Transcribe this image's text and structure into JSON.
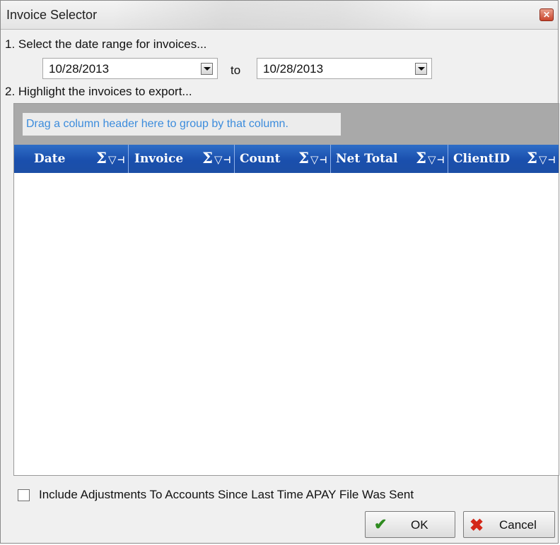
{
  "window": {
    "title": "Invoice Selector"
  },
  "steps": {
    "step1": "1.  Select the date range for invoices...",
    "step2": "2.  Highlight the invoices to export..."
  },
  "date_range": {
    "from": "10/28/2013",
    "to_label": "to",
    "to": "10/28/2013"
  },
  "grid": {
    "group_hint": "Drag a column header here to group by that column.",
    "columns": [
      {
        "label": "Date"
      },
      {
        "label": "Invoice"
      },
      {
        "label": "Count"
      },
      {
        "label": "Net Total"
      },
      {
        "label": "ClientID"
      }
    ],
    "column_icons": {
      "sum": "Σ",
      "filter": "▽",
      "pin": "⊣"
    },
    "rows": []
  },
  "options": {
    "include_adjustments_label": "Include Adjustments To Accounts Since Last Time APAY File Was Sent",
    "include_adjustments_checked": false
  },
  "buttons": {
    "ok": "OK",
    "cancel": "Cancel"
  },
  "icons": {
    "ok": "check-icon",
    "cancel": "x-icon",
    "close": "close-icon",
    "dropdown": "chevron-down-icon"
  },
  "colors": {
    "header": "#1a4fad",
    "group_area": "#a9a9a9",
    "hint_text": "#3c8cdc",
    "close": "#c9452c"
  }
}
